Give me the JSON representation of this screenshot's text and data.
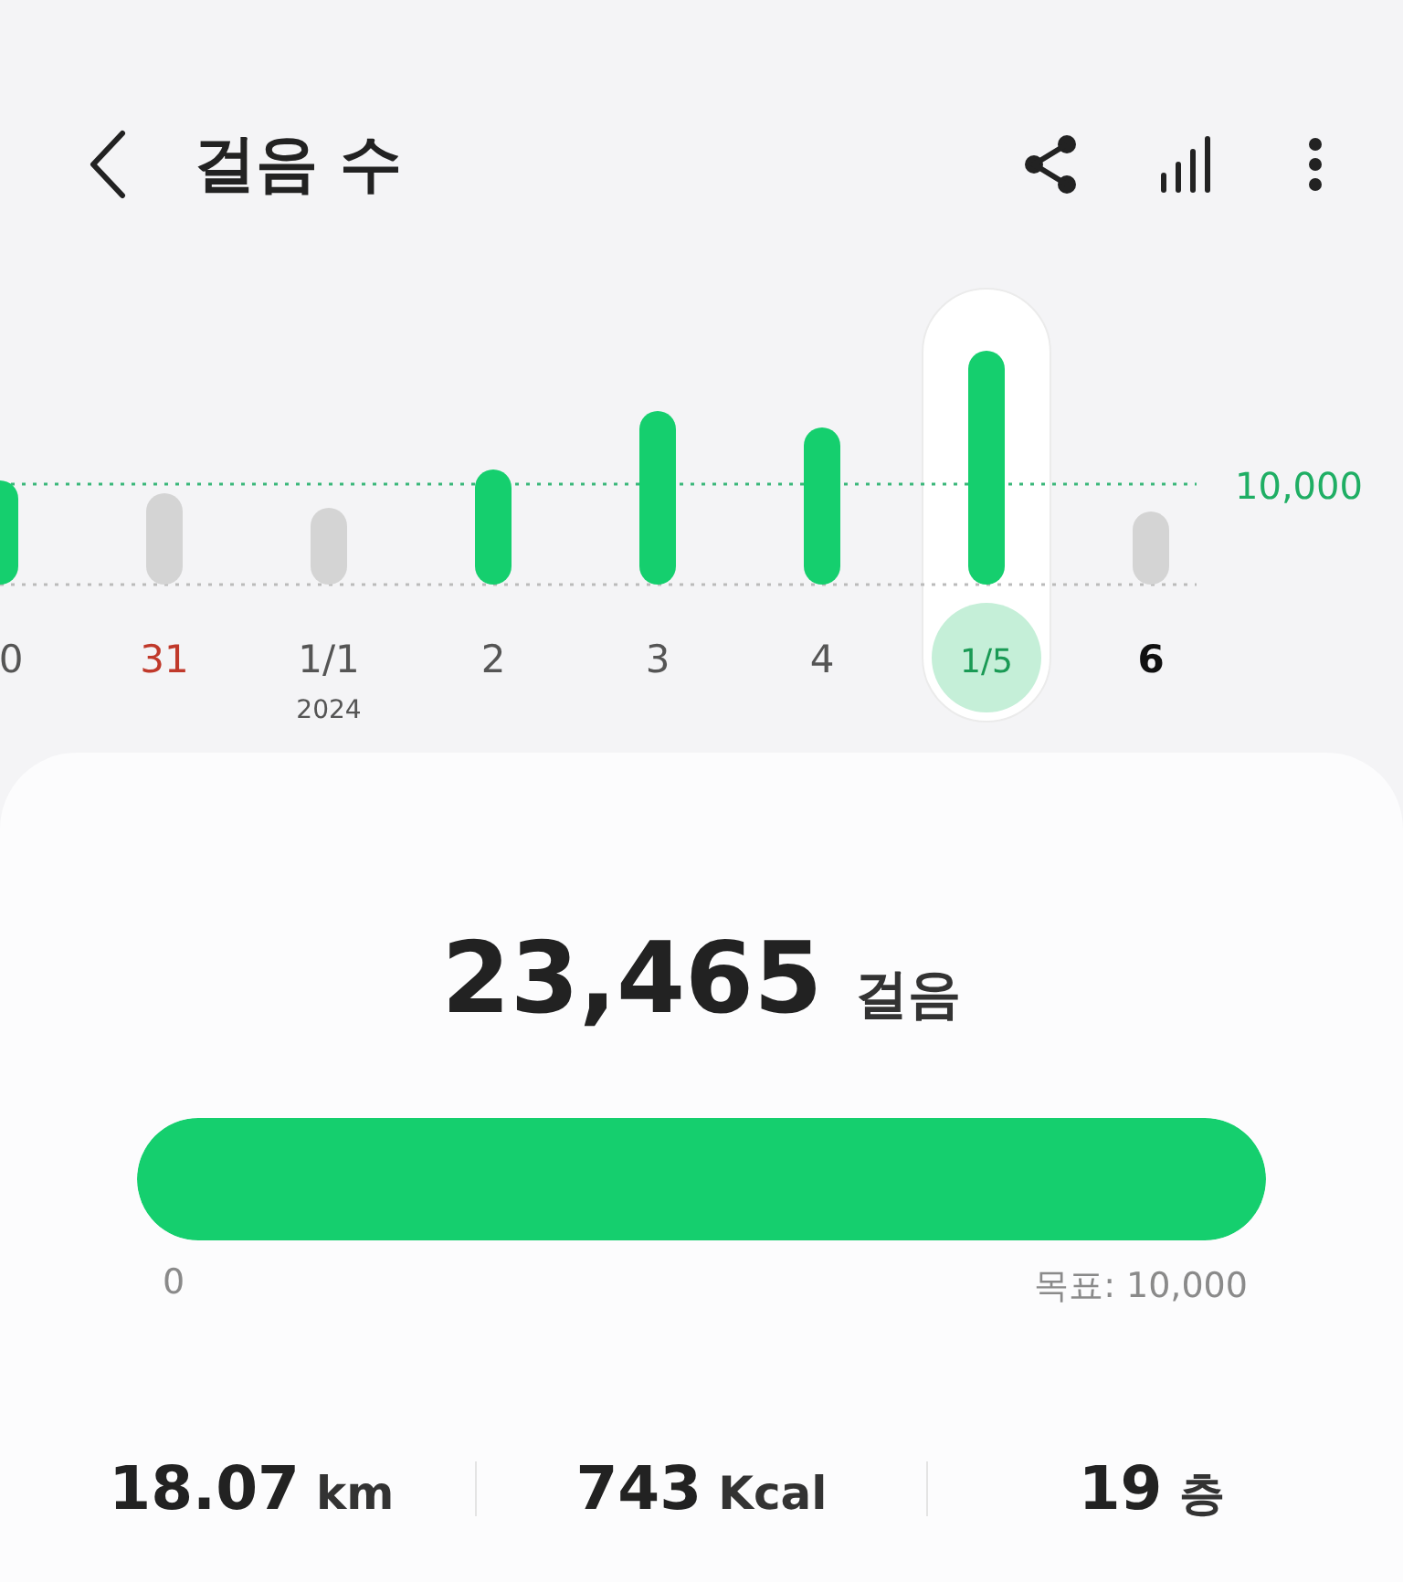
{
  "header": {
    "title": "걸음 수"
  },
  "goal_line_label": "10,000",
  "days": [
    {
      "label": "0",
      "selected": false,
      "sunday": false,
      "today": false
    },
    {
      "label": "31",
      "selected": false,
      "sunday": true,
      "today": false
    },
    {
      "label": "1/1",
      "selected": false,
      "sunday": false,
      "today": false,
      "sublabel": "2024"
    },
    {
      "label": "2",
      "selected": false,
      "sunday": false,
      "today": false
    },
    {
      "label": "3",
      "selected": false,
      "sunday": false,
      "today": false
    },
    {
      "label": "4",
      "selected": false,
      "sunday": false,
      "today": false
    },
    {
      "label": "1/5",
      "selected": true,
      "sunday": false,
      "today": false
    },
    {
      "label": "6",
      "selected": false,
      "sunday": false,
      "today": true
    }
  ],
  "summary": {
    "steps": "23,465",
    "unit": "걸음",
    "level": 1.0,
    "min_label": "0",
    "goal_label": "목표: 10,000"
  },
  "stats": [
    {
      "value": "18.07",
      "unit": "km"
    },
    {
      "value": "743",
      "unit": "Kcal"
    },
    {
      "value": "19",
      "unit": "층"
    }
  ]
}
